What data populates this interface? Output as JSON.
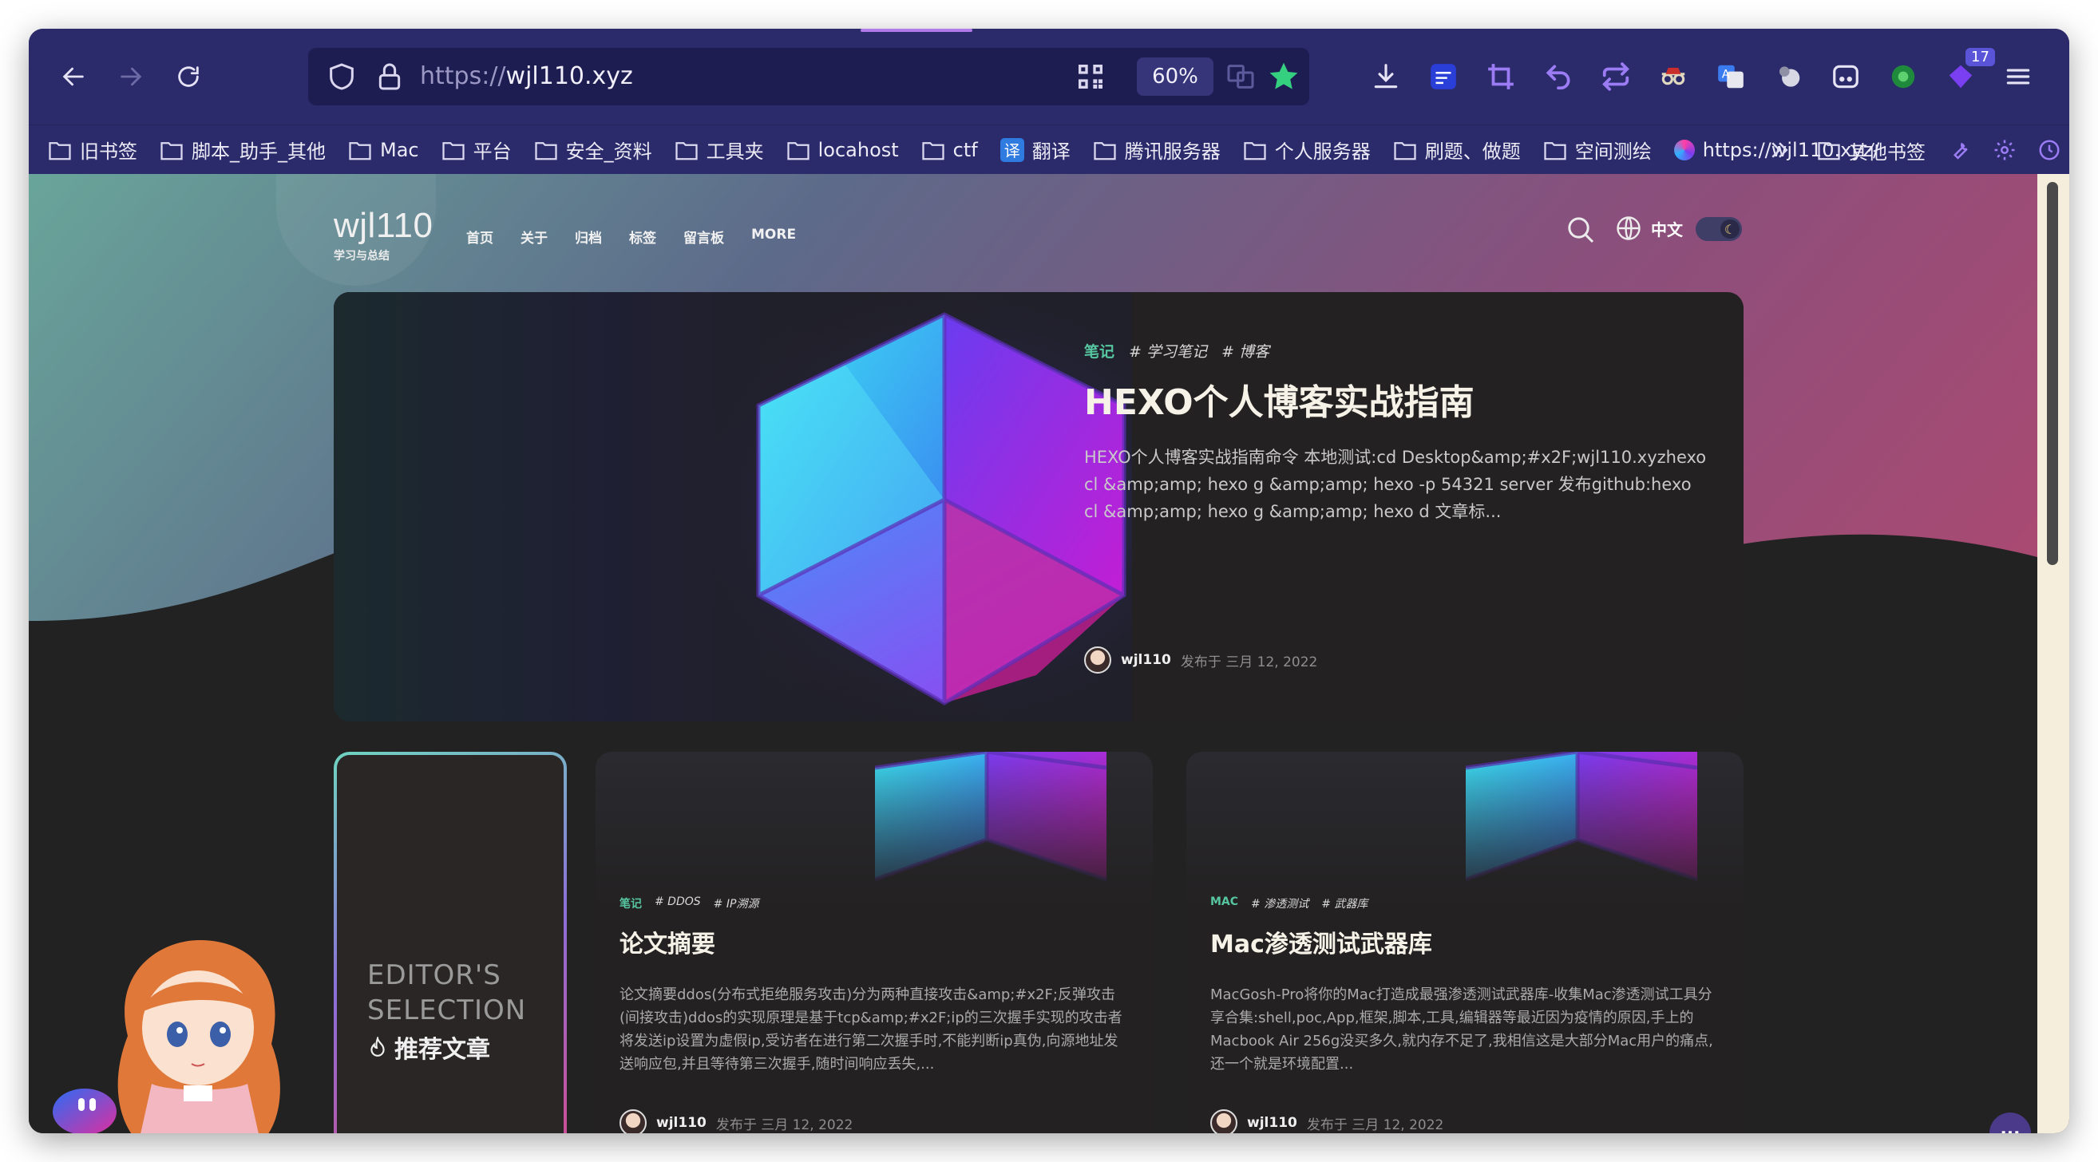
{
  "browser": {
    "url_scheme": "https://",
    "url_host": "wjl110.xyz",
    "zoom": "60%",
    "badge_count": "17",
    "bookmarks": [
      "旧书签",
      "脚本_助手_其他",
      "Mac",
      "平台",
      "安全_资料",
      "工具夹",
      "locahost",
      "ctf",
      "翻译",
      "腾讯服务器",
      "个人服务器",
      "刷题、做题",
      "空间测绘",
      "https://wjl110.xyz/"
    ],
    "other_bookmarks": "其他书签",
    "fanyi_glyph": "译"
  },
  "site": {
    "logo": "wjl110",
    "subtitle": "学习与总结",
    "nav": [
      "首页",
      "关于",
      "归档",
      "标签",
      "留言板",
      "MORE"
    ],
    "lang": "中文"
  },
  "hero": {
    "category": "笔记",
    "tags": [
      "# 学习笔记",
      "# 博客"
    ],
    "title": "HEXO个人博客实战指南",
    "description": "HEXO个人博客实战指南命令 本地测试:cd Desktop&amp;#x2F;wjl110.xyzhexo cl &amp;amp; hexo g &amp;amp; hexo -p 54321 server 发布github:hexo cl &amp;amp; hexo g &amp;amp; hexo d 文章标...",
    "author": "wjl110",
    "date": "发布于 三月 12, 2022"
  },
  "editors": {
    "line1": "EDITOR'S",
    "line2": "SELECTION",
    "label": "推荐文章"
  },
  "cards": [
    {
      "category": "笔记",
      "tags": [
        "# DDOS",
        "# IP溯源"
      ],
      "title": "论文摘要",
      "description": "论文摘要ddos(分布式拒绝服务攻击)分为两种直接攻击&amp;#x2F;反弹攻击(间接攻击)ddos的实现原理是基于tcp&amp;#x2F;ip的三次握手实现的攻击者将发送ip设置为虚假ip,受访者在进行第二次握手时,不能判断ip真伪,向源地址发送响应包,并且等待第三次握手,随时间响应丢失,...",
      "author": "wjl110",
      "date": "发布于 三月 12, 2022"
    },
    {
      "category": "MAC",
      "tags": [
        "# 渗透测试",
        "# 武器库"
      ],
      "title": "Mac渗透测试武器库",
      "description": "MacGosh-Pro将你的Mac打造成最强渗透测试武器库-收集Mac渗透测试工具分享合集:shell,poc,App,框架,脚本,工具,编辑器等最近因为疫情的原因,手上的Macbook Air 256g没买多久,就内存不足了,我相信这是大部分Mac用户的痛点,还一个就是环境配置...",
      "author": "wjl110",
      "date": "发布于 三月 12, 2022"
    }
  ],
  "chat_button": "···",
  "colors": {
    "toolbar": "#2b2a6b",
    "accent_tag": "#56c6a0",
    "title": "#f6f2e8"
  }
}
